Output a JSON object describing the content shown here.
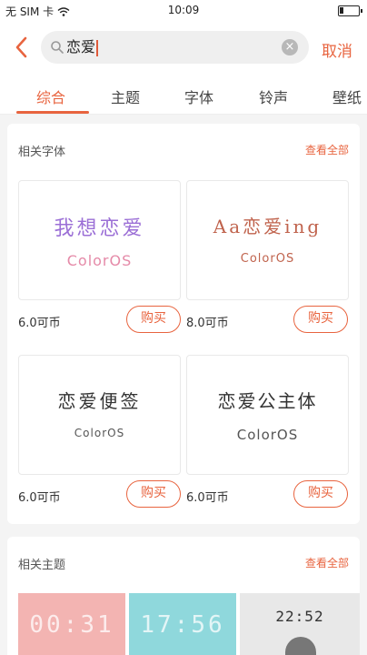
{
  "status_bar": {
    "carrier": "无 SIM 卡",
    "time": "10:09"
  },
  "search": {
    "value": "恋爱",
    "cancel_label": "取消"
  },
  "tabs": [
    {
      "label": "综合",
      "active": true
    },
    {
      "label": "主题"
    },
    {
      "label": "字体"
    },
    {
      "label": "铃声"
    },
    {
      "label": "壁纸"
    }
  ],
  "fonts_section": {
    "title": "相关字体",
    "see_all": "查看全部",
    "items": [
      {
        "preview_cn": "我想恋爱",
        "preview_en": "ColorOS",
        "price": "6.0可币",
        "buy_label": "购买"
      },
      {
        "preview_cn": "Aa恋爱ing",
        "preview_en": "ColorOS",
        "price": "8.0可币",
        "buy_label": "购买"
      },
      {
        "preview_cn": "恋爱便签",
        "preview_en": "ColorOS",
        "price": "6.0可币",
        "buy_label": "购买"
      },
      {
        "preview_cn": "恋爱公主体",
        "preview_en": "ColorOS",
        "price": "6.0可币",
        "buy_label": "购买"
      }
    ]
  },
  "themes_section": {
    "title": "相关主题",
    "see_all": "查看全部",
    "items": [
      {
        "clock": "00:31",
        "bg": "#f3b4b2"
      },
      {
        "clock": "17:56",
        "bg": "#8fd8dc"
      },
      {
        "clock": "22:52",
        "bg": "#e8e8e8"
      }
    ]
  },
  "colors": {
    "accent": "#e8643f"
  }
}
